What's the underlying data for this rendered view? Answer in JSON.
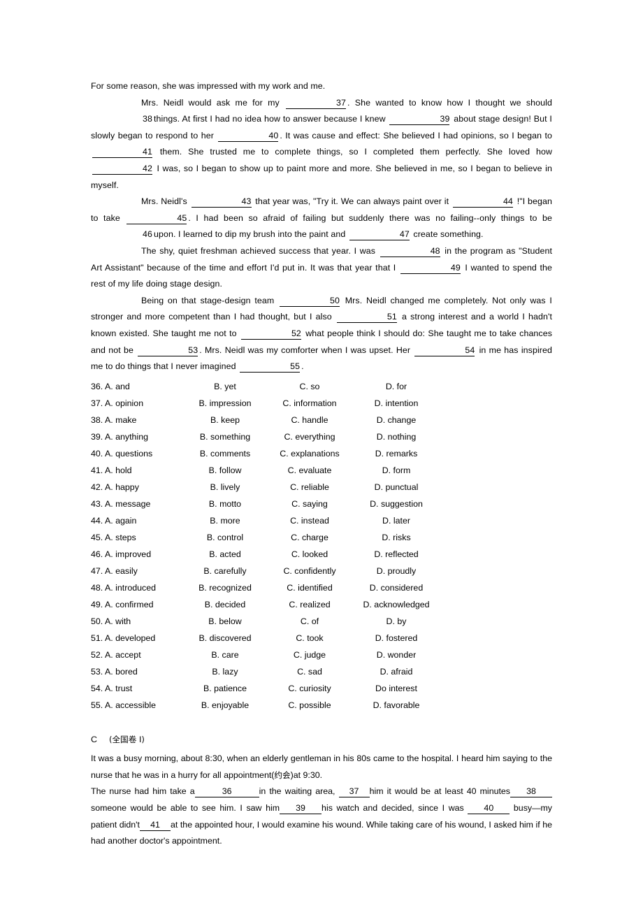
{
  "passage_b": {
    "lines": [
      {
        "id": "pb-l1",
        "indent": false,
        "segments": [
          {
            "t": "text",
            "v": "For some reason, she was impressed with my work and me."
          }
        ]
      },
      {
        "id": "pb-l2",
        "indent": true,
        "segments": [
          {
            "t": "text",
            "v": "Mrs. Neidl would ask me for my "
          },
          {
            "t": "blank",
            "v": "37",
            "style": "w1"
          },
          {
            "t": "text",
            "v": ". She wanted to know how I thought we should "
          },
          {
            "t": "blank",
            "v": "38",
            "style": "plain"
          },
          {
            "t": "text",
            "v": "things. At first I had no idea how to answer because I knew "
          },
          {
            "t": "blank",
            "v": "39",
            "style": "w2"
          },
          {
            "t": "text",
            "v": " about stage design! But I slowly began to respond to her "
          },
          {
            "t": "blank",
            "v": "40",
            "style": "w2"
          },
          {
            "t": "text",
            "v": ". It was cause and effect: She believed I had opinions, so I began to "
          },
          {
            "t": "blank",
            "v": "41",
            "style": "w2"
          },
          {
            "t": "text",
            "v": " them. She trusted me to complete things, so I completed them perfectly. She loved how "
          },
          {
            "t": "blank",
            "v": "42",
            "style": "w2"
          },
          {
            "t": "text",
            "v": " I was, so I began to show up to paint more and more. She believed in me, so I began to believe in myself."
          }
        ]
      },
      {
        "id": "pb-l3",
        "indent": true,
        "segments": [
          {
            "t": "text",
            "v": "Mrs. Neidl's "
          },
          {
            "t": "blank",
            "v": "43",
            "style": "w2"
          },
          {
            "t": "text",
            "v": " that year was, \"Try it. We can always paint over it "
          },
          {
            "t": "blank",
            "v": "44",
            "style": "w2"
          },
          {
            "t": "text",
            "v": " !\"I began to take "
          },
          {
            "t": "blank",
            "v": "45",
            "style": "w2"
          },
          {
            "t": "text",
            "v": ". I had been so afraid of failing but suddenly there was no failing--only things to be "
          },
          {
            "t": "blank",
            "v": "46",
            "style": "plain"
          },
          {
            "t": "text",
            "v": "upon. I learned to dip my brush into the paint and "
          },
          {
            "t": "blank",
            "v": "47",
            "style": "w2"
          },
          {
            "t": "text",
            "v": " create something."
          }
        ]
      },
      {
        "id": "pb-l4",
        "indent": true,
        "segments": [
          {
            "t": "text",
            "v": "The shy, quiet freshman achieved success that year. I was "
          },
          {
            "t": "blank",
            "v": "48",
            "style": "w2"
          },
          {
            "t": "text",
            "v": " in the program as \"Student Art Assistant\" because of the time and effort I'd put in. It was that year that I "
          },
          {
            "t": "blank",
            "v": "49",
            "style": "w2"
          },
          {
            "t": "text",
            "v": " I wanted to spend the rest of my life doing stage design."
          }
        ]
      },
      {
        "id": "pb-l5",
        "indent": true,
        "segments": [
          {
            "t": "text",
            "v": "Being on that stage-design team "
          },
          {
            "t": "blank",
            "v": "50",
            "style": "w1"
          },
          {
            "t": "text",
            "v": " Mrs. Neidl changed me completely. Not only was I stronger and more competent than I had thought, but I also "
          },
          {
            "t": "blank",
            "v": "51",
            "style": "w2"
          },
          {
            "t": "text",
            "v": " a strong interest and a world I hadn't known existed. She taught me not to "
          },
          {
            "t": "blank",
            "v": "52",
            "style": "w1"
          },
          {
            "t": "text",
            "v": " what people think I should do: She taught me to take chances and not be "
          },
          {
            "t": "blank",
            "v": "53",
            "style": "w2"
          },
          {
            "t": "text",
            "v": ". Mrs. Neidl was my comforter when I was upset. Her "
          },
          {
            "t": "blank",
            "v": "54",
            "style": "w2"
          },
          {
            "t": "text",
            "v": " in me has inspired me to do things that I never imagined "
          },
          {
            "t": "blank",
            "v": "55",
            "style": "w2"
          },
          {
            "t": "text",
            "v": "."
          }
        ]
      }
    ]
  },
  "options": [
    {
      "num": "36",
      "a": "36. A. and",
      "b": "B. yet",
      "c": "C. so",
      "d": "D. for"
    },
    {
      "num": "37",
      "a": "37. A. opinion",
      "b": "B. impression",
      "c": "C. information",
      "d": "D. intention"
    },
    {
      "num": "38",
      "a": "38. A. make",
      "b": "B. keep",
      "c": "C. handle",
      "d": "D. change"
    },
    {
      "num": "39",
      "a": "39. A. anything",
      "b": "B. something",
      "c": "C. everything",
      "d": "D. nothing"
    },
    {
      "num": "40",
      "a": "40. A. questions",
      "b": "B. comments",
      "c": "C. explanations",
      "d": "D. remarks"
    },
    {
      "num": "41",
      "a": "41. A. hold",
      "b": "B. follow",
      "c": "C. evaluate",
      "d": "D. form"
    },
    {
      "num": "42",
      "a": "42. A. happy",
      "b": "B. lively",
      "c": "C. reliable",
      "d": "D. punctual"
    },
    {
      "num": "43",
      "a": "43. A. message",
      "b": "B. motto",
      "c": "C. saying",
      "d": "D. suggestion"
    },
    {
      "num": "44",
      "a": "44. A. again",
      "b": "B. more",
      "c": "C. instead",
      "d": "D. later"
    },
    {
      "num": "45",
      "a": "45. A. steps",
      "b": "B. control",
      "c": "C. charge",
      "d": "D. risks"
    },
    {
      "num": "46",
      "a": "46. A. improved",
      "b": "B. acted",
      "c": "C. looked",
      "d": "D. reflected"
    },
    {
      "num": "47",
      "a": "47. A. easily",
      "b": "B. carefully",
      "c": "C. confidently",
      "d": "D. proudly"
    },
    {
      "num": "48",
      "a": "48. A. introduced",
      "b": "B. recognized",
      "c": "C. identified",
      "d": "D. considered"
    },
    {
      "num": "49",
      "a": "49. A. confirmed",
      "b": "B. decided",
      "c": "C. realized",
      "d": "D. acknowledged"
    },
    {
      "num": "50",
      "a": "50. A. with",
      "b": "B. below",
      "c": "C. of",
      "d": "D. by"
    },
    {
      "num": "51",
      "a": "51. A. developed",
      "b": "B. discovered",
      "c": "C. took",
      "d": "D. fostered"
    },
    {
      "num": "52",
      "a": "52. A. accept",
      "b": "B. care",
      "c": "C. judge",
      "d": "D. wonder"
    },
    {
      "num": "53",
      "a": "53. A. bored",
      "b": "B. lazy",
      "c": "C. sad",
      "d": "D. afraid"
    },
    {
      "num": "54",
      "a": "54. A. trust",
      "b": "B. patience",
      "c": "C. curiosity",
      "d": "Do interest"
    },
    {
      "num": "55",
      "a": "55. A. accessible",
      "b": "B. enjoyable",
      "c": "C. possible",
      "d": "D. favorable"
    }
  ],
  "section_c": {
    "label": "C",
    "source": "(全国卷 I)"
  },
  "passage_c": {
    "lines": [
      {
        "id": "pc-l1",
        "segments": [
          {
            "t": "text",
            "v": "It was a busy morning, about 8:30, when an elderly gentleman in his 80s came to the hospital. I heard him saying to the nurse that he was in a hurry for all appointment("
          },
          {
            "t": "cn",
            "v": "约会"
          },
          {
            "t": "text",
            "v": ")at 9:30."
          }
        ]
      },
      {
        "id": "pc-l2",
        "segments": [
          {
            "t": "text",
            "v": "The nurse had him take a"
          },
          {
            "t": "blank",
            "v": "36",
            "style": "long"
          },
          {
            "t": "text",
            "v": "in the waiting area, "
          },
          {
            "t": "blank",
            "v": "37",
            "style": "short"
          },
          {
            "t": "text",
            "v": "him it would be at least 40 minutes"
          },
          {
            "t": "blank",
            "v": "38",
            "style": "mid"
          },
          {
            "t": "text",
            "v": "someone would be able to see him. I saw him"
          },
          {
            "t": "blank",
            "v": "39",
            "style": "mid"
          },
          {
            "t": "text",
            "v": "his watch and decided, since I was "
          },
          {
            "t": "blank",
            "v": "40",
            "style": "mid"
          },
          {
            "t": "text",
            "v": " busy—my patient didn't"
          },
          {
            "t": "blank",
            "v": "41",
            "style": "short"
          },
          {
            "t": "text",
            "v": "at the appointed hour, I would examine his wound. While taking care of his wound, I asked him if he had another doctor's appointment."
          }
        ]
      }
    ]
  }
}
